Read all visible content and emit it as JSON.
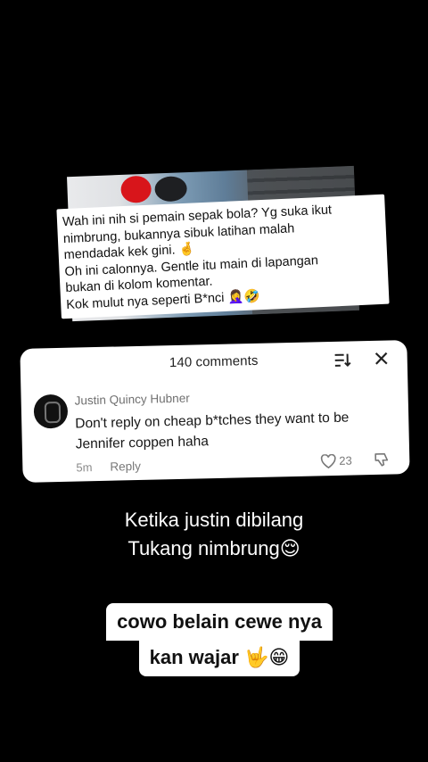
{
  "screenshot_comment": {
    "lines": [
      "Wah ini nih si pemain sepak bola? Yg suka ikut",
      "nimbrung, bukannya sibuk latihan malah",
      "mendadak kek gini. 🤞",
      "Oh ini calonnya. Gentle itu main di lapangan",
      "bukan di kolom komentar.",
      "Kok mulut nya seperti B*nci 🤦‍♀️🤣"
    ]
  },
  "comments_panel": {
    "title": "140 comments",
    "comment": {
      "username": "Justin Quincy Hubner",
      "text": "Don't reply on cheap b*tches they want to be Jennifer coppen haha",
      "time": "5m",
      "reply_label": "Reply",
      "likes": "23"
    }
  },
  "caption": {
    "line1": "Ketika justin dibilang",
    "line2": "Tukang nimbrung😌"
  },
  "label": {
    "line1": "cowo belain cewe nya",
    "line2": "kan wajar 🤟😁"
  },
  "icons": [
    "sort-icon",
    "close-icon",
    "heart-icon",
    "dislike-icon"
  ]
}
